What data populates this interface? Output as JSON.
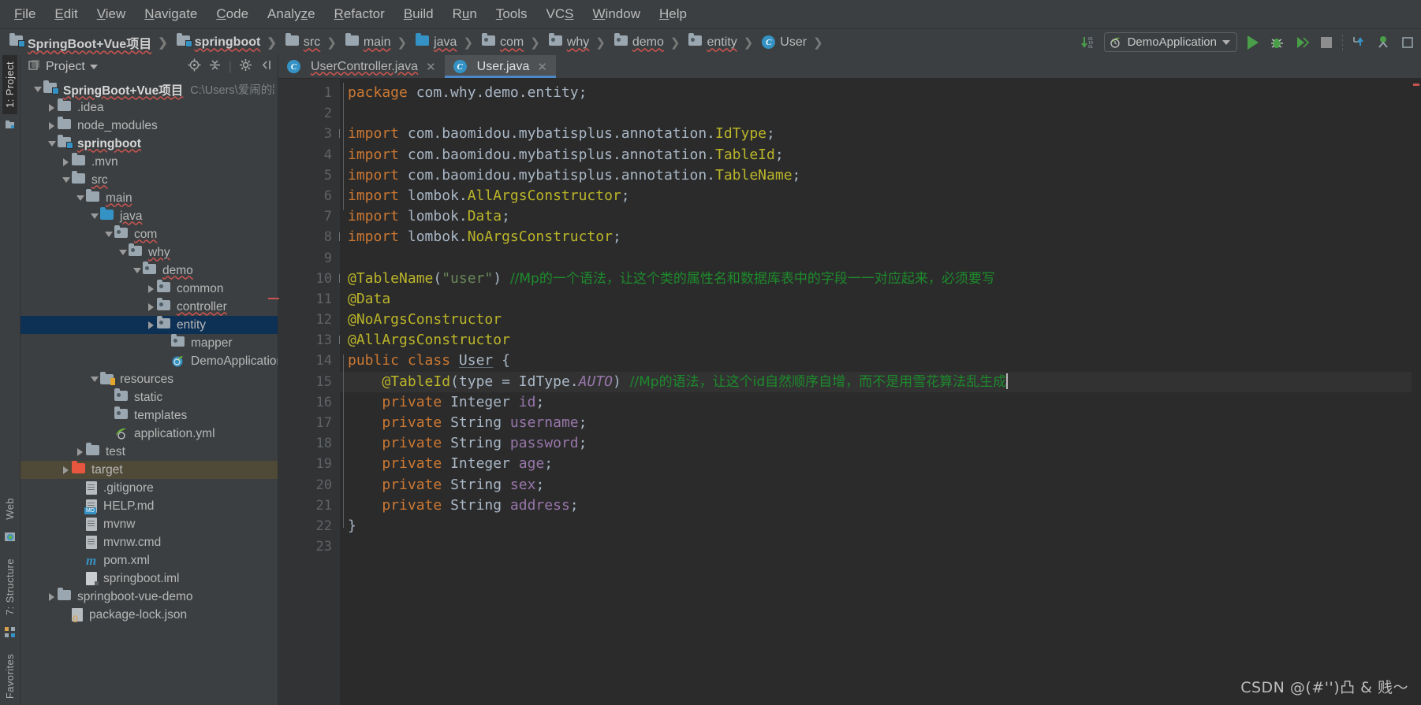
{
  "menubar": {
    "items": [
      "File",
      "Edit",
      "View",
      "Navigate",
      "Code",
      "Analyze",
      "Refactor",
      "Build",
      "Run",
      "Tools",
      "VCS",
      "Window",
      "Help"
    ]
  },
  "breadcrumb": {
    "items": [
      {
        "label": "SpringBoot+Vue项目",
        "icon": "module-icon",
        "bold": true
      },
      {
        "label": "springboot",
        "icon": "module-icon",
        "bold": true
      },
      {
        "label": "src",
        "icon": "folder-icon",
        "bold": false
      },
      {
        "label": "main",
        "icon": "folder-icon",
        "bold": false
      },
      {
        "label": "java",
        "icon": "source-folder-icon",
        "bold": false
      },
      {
        "label": "com",
        "icon": "package-icon",
        "bold": false
      },
      {
        "label": "why",
        "icon": "package-icon",
        "bold": false
      },
      {
        "label": "demo",
        "icon": "package-icon",
        "bold": false
      },
      {
        "label": "entity",
        "icon": "package-icon",
        "bold": false
      },
      {
        "label": "User",
        "icon": "class-icon",
        "bold": false
      }
    ]
  },
  "toolbar": {
    "update_project_icon": "update-project-icon",
    "run_config_name": "DemoApplication",
    "run_config_icon": "spring-boot-icon",
    "dropdown_icon": "chevron-down-icon",
    "run_icon": "run-icon",
    "debug_icon": "debug-icon",
    "coverage_icon": "run-with-coverage-icon",
    "stop_icon": "stop-icon",
    "update_vcs_icon": "vcs-update-icon",
    "commit_icon": "vcs-commit-icon",
    "extra_icon": "more-icon"
  },
  "rail": {
    "left_tabs": [
      "1: Project",
      "Web",
      "7: Structure",
      "Favorites"
    ],
    "active": "1: Project"
  },
  "project_panel": {
    "title": "Project",
    "title_dropdown_icon": "chevron-down-icon",
    "actions": [
      "locate-icon",
      "collapse-all-icon",
      "settings-gear-icon",
      "hide-icon"
    ],
    "tree": [
      {
        "depth": 0,
        "label": "SpringBoot+Vue项目",
        "twist": "down",
        "icon": "module-icon",
        "bold": true,
        "squiggle": true,
        "path": "C:\\Users\\爱闹的蹦蹦\\De"
      },
      {
        "depth": 1,
        "label": ".idea",
        "twist": "right",
        "icon": "folder-icon"
      },
      {
        "depth": 1,
        "label": "node_modules",
        "twist": "right",
        "icon": "folder-icon"
      },
      {
        "depth": 1,
        "label": "springboot",
        "twist": "down",
        "icon": "module-icon",
        "bold": true,
        "squiggle": true
      },
      {
        "depth": 2,
        "label": ".mvn",
        "twist": "right",
        "icon": "folder-icon"
      },
      {
        "depth": 2,
        "label": "src",
        "twist": "down",
        "icon": "folder-icon",
        "squiggle": true
      },
      {
        "depth": 3,
        "label": "main",
        "twist": "down",
        "icon": "folder-icon",
        "squiggle": true
      },
      {
        "depth": 4,
        "label": "java",
        "twist": "down",
        "icon": "source-folder-icon",
        "squiggle": true
      },
      {
        "depth": 5,
        "label": "com",
        "twist": "down",
        "icon": "package-icon",
        "squiggle": true
      },
      {
        "depth": 6,
        "label": "why",
        "twist": "down",
        "icon": "package-icon",
        "squiggle": true
      },
      {
        "depth": 7,
        "label": "demo",
        "twist": "down",
        "icon": "package-icon",
        "squiggle": true
      },
      {
        "depth": 8,
        "label": "common",
        "twist": "right",
        "icon": "package-icon"
      },
      {
        "depth": 8,
        "label": "controller",
        "twist": "right",
        "icon": "package-icon",
        "squiggle": true
      },
      {
        "depth": 8,
        "label": "entity",
        "twist": "right",
        "icon": "package-icon",
        "selected": true
      },
      {
        "depth": 9,
        "label": "mapper",
        "twist": "none",
        "icon": "package-icon"
      },
      {
        "depth": 9,
        "label": "DemoApplication",
        "twist": "none",
        "icon": "spring-class-icon"
      },
      {
        "depth": 4,
        "label": "resources",
        "twist": "down",
        "icon": "resources-folder-icon"
      },
      {
        "depth": 5,
        "label": "static",
        "twist": "none",
        "icon": "package-icon"
      },
      {
        "depth": 5,
        "label": "templates",
        "twist": "none",
        "icon": "package-icon"
      },
      {
        "depth": 5,
        "label": "application.yml",
        "twist": "none",
        "icon": "spring-yml-icon"
      },
      {
        "depth": 3,
        "label": "test",
        "twist": "right",
        "icon": "folder-icon"
      },
      {
        "depth": 2,
        "label": "target",
        "twist": "right",
        "icon": "target-folder-icon",
        "highlight": true
      },
      {
        "depth": 3,
        "label": ".gitignore",
        "twist": "none",
        "icon": "file-icon"
      },
      {
        "depth": 3,
        "label": "HELP.md",
        "twist": "none",
        "icon": "markdown-file-icon"
      },
      {
        "depth": 3,
        "label": "mvnw",
        "twist": "none",
        "icon": "file-icon"
      },
      {
        "depth": 3,
        "label": "mvnw.cmd",
        "twist": "none",
        "icon": "file-icon"
      },
      {
        "depth": 3,
        "label": "pom.xml",
        "twist": "none",
        "icon": "maven-pom-icon"
      },
      {
        "depth": 3,
        "label": "springboot.iml",
        "twist": "none",
        "icon": "iml-file-icon"
      },
      {
        "depth": 1,
        "label": "springboot-vue-demo",
        "twist": "right",
        "icon": "folder-icon"
      },
      {
        "depth": 2,
        "label": "package-lock.json",
        "twist": "none",
        "icon": "json-file-icon"
      }
    ]
  },
  "editor": {
    "tabs": [
      {
        "label": "UserController.java",
        "icon": "class-icon",
        "active": false,
        "squiggle": true,
        "close_icon": "close-icon"
      },
      {
        "label": "User.java",
        "icon": "class-icon",
        "active": true,
        "squiggle": false,
        "close_icon": "close-icon"
      }
    ],
    "line_numbers": [
      "1",
      "2",
      "3",
      "4",
      "5",
      "6",
      "7",
      "8",
      "9",
      "10",
      "11",
      "12",
      "13",
      "14",
      "15",
      "16",
      "17",
      "18",
      "19",
      "20",
      "21",
      "22",
      "23"
    ],
    "caret_line": 15,
    "bulb_icon": "intention-bulb-icon",
    "code_lines": [
      {
        "n": 1,
        "segments": [
          {
            "t": "package ",
            "c": "kw"
          },
          {
            "t": "com.why.demo.entity;",
            "c": "typ"
          }
        ]
      },
      {
        "n": 2,
        "segments": []
      },
      {
        "n": 3,
        "segments": [
          {
            "t": "import ",
            "c": "kw"
          },
          {
            "t": "com.baomidou.mybatisplus.annotation.",
            "c": "typ"
          },
          {
            "t": "IdType",
            "c": "ann"
          },
          {
            "t": ";",
            "c": "typ"
          }
        ],
        "fold": "minus"
      },
      {
        "n": 4,
        "segments": [
          {
            "t": "import ",
            "c": "kw"
          },
          {
            "t": "com.baomidou.mybatisplus.annotation.",
            "c": "typ"
          },
          {
            "t": "TableId",
            "c": "ann"
          },
          {
            "t": ";",
            "c": "typ"
          }
        ]
      },
      {
        "n": 5,
        "segments": [
          {
            "t": "import ",
            "c": "kw"
          },
          {
            "t": "com.baomidou.mybatisplus.annotation.",
            "c": "typ"
          },
          {
            "t": "TableName",
            "c": "ann"
          },
          {
            "t": ";",
            "c": "typ"
          }
        ]
      },
      {
        "n": 6,
        "segments": [
          {
            "t": "import ",
            "c": "kw"
          },
          {
            "t": "lombok.",
            "c": "typ"
          },
          {
            "t": "AllArgsConstructor",
            "c": "ann"
          },
          {
            "t": ";",
            "c": "typ"
          }
        ]
      },
      {
        "n": 7,
        "segments": [
          {
            "t": "import ",
            "c": "kw"
          },
          {
            "t": "lombok.",
            "c": "typ"
          },
          {
            "t": "Data",
            "c": "ann"
          },
          {
            "t": ";",
            "c": "typ"
          }
        ]
      },
      {
        "n": 8,
        "segments": [
          {
            "t": "import ",
            "c": "kw"
          },
          {
            "t": "lombok.",
            "c": "typ"
          },
          {
            "t": "NoArgsConstructor",
            "c": "ann"
          },
          {
            "t": ";",
            "c": "typ"
          }
        ],
        "fold": "end"
      },
      {
        "n": 9,
        "segments": []
      },
      {
        "n": 10,
        "segments": [
          {
            "t": "@TableName",
            "c": "ann"
          },
          {
            "t": "(",
            "c": "punct"
          },
          {
            "t": "\"user\"",
            "c": "str"
          },
          {
            "t": ") ",
            "c": "punct"
          },
          {
            "t": "//Mp的一个语法，让这个类的属性名和数据库表中的字段一一对应起来，必须要写",
            "c": "cmt-zh"
          }
        ],
        "fold": "minus"
      },
      {
        "n": 11,
        "segments": [
          {
            "t": "@Data",
            "c": "ann"
          }
        ]
      },
      {
        "n": 12,
        "segments": [
          {
            "t": "@NoArgsConstructor",
            "c": "ann"
          }
        ]
      },
      {
        "n": 13,
        "segments": [
          {
            "t": "@AllArgsConstructor",
            "c": "ann"
          }
        ],
        "fold": "minus"
      },
      {
        "n": 14,
        "segments": [
          {
            "t": "public ",
            "c": "kw"
          },
          {
            "t": "class ",
            "c": "kw"
          },
          {
            "t": "User",
            "c": "cname"
          },
          {
            "t": " {",
            "c": "punct"
          }
        ]
      },
      {
        "n": 15,
        "segments": [
          {
            "t": "    ",
            "c": "typ"
          },
          {
            "t": "@TableId",
            "c": "ann"
          },
          {
            "t": "(",
            "c": "punct"
          },
          {
            "t": "type",
            "c": "typ"
          },
          {
            "t": " = ",
            "c": "punct"
          },
          {
            "t": "IdType.",
            "c": "typ"
          },
          {
            "t": "AUTO",
            "c": "ital"
          },
          {
            "t": ") ",
            "c": "punct"
          },
          {
            "t": "//Mp的语法，让这个id自然顺序自增，而不是用雪花算法乱生成",
            "c": "cmt-zh"
          }
        ],
        "bulb": true,
        "highlight": true,
        "caret": true
      },
      {
        "n": 16,
        "segments": [
          {
            "t": "    ",
            "c": "typ"
          },
          {
            "t": "private ",
            "c": "kw"
          },
          {
            "t": "Integer ",
            "c": "typ"
          },
          {
            "t": "id",
            "c": "fld"
          },
          {
            "t": ";",
            "c": "punct"
          }
        ]
      },
      {
        "n": 17,
        "segments": [
          {
            "t": "    ",
            "c": "typ"
          },
          {
            "t": "private ",
            "c": "kw"
          },
          {
            "t": "String ",
            "c": "typ"
          },
          {
            "t": "username",
            "c": "fld"
          },
          {
            "t": ";",
            "c": "punct"
          }
        ]
      },
      {
        "n": 18,
        "segments": [
          {
            "t": "    ",
            "c": "typ"
          },
          {
            "t": "private ",
            "c": "kw"
          },
          {
            "t": "String ",
            "c": "typ"
          },
          {
            "t": "password",
            "c": "fld"
          },
          {
            "t": ";",
            "c": "punct"
          }
        ]
      },
      {
        "n": 19,
        "segments": [
          {
            "t": "    ",
            "c": "typ"
          },
          {
            "t": "private ",
            "c": "kw"
          },
          {
            "t": "Integer ",
            "c": "typ"
          },
          {
            "t": "age",
            "c": "fld"
          },
          {
            "t": ";",
            "c": "punct"
          }
        ]
      },
      {
        "n": 20,
        "segments": [
          {
            "t": "    ",
            "c": "typ"
          },
          {
            "t": "private ",
            "c": "kw"
          },
          {
            "t": "String ",
            "c": "typ"
          },
          {
            "t": "sex",
            "c": "fld"
          },
          {
            "t": ";",
            "c": "punct"
          }
        ]
      },
      {
        "n": 21,
        "segments": [
          {
            "t": "    ",
            "c": "typ"
          },
          {
            "t": "private ",
            "c": "kw"
          },
          {
            "t": "String ",
            "c": "typ"
          },
          {
            "t": "address",
            "c": "fld"
          },
          {
            "t": ";",
            "c": "punct"
          }
        ]
      },
      {
        "n": 22,
        "segments": [
          {
            "t": "}",
            "c": "punct"
          }
        ]
      },
      {
        "n": 23,
        "segments": []
      }
    ]
  },
  "watermark": "CSDN @(#'')凸 & 贱～",
  "colors": {
    "background": "#3c3f41",
    "editor_background": "#2b2b2b",
    "gutter_background": "#313335",
    "selection_blue": "#0d3055",
    "accent_blue": "#3592c4",
    "tab_underline": "#4a88c7",
    "keyword_orange": "#cc7832",
    "annotation_yellow": "#bbb529",
    "string_green": "#6a8759",
    "comment_green": "#1d8b2c",
    "field_purple": "#9876aa",
    "error_red": "#c75450",
    "run_green": "#4a9e49",
    "target_highlight": "#4f4a37"
  }
}
